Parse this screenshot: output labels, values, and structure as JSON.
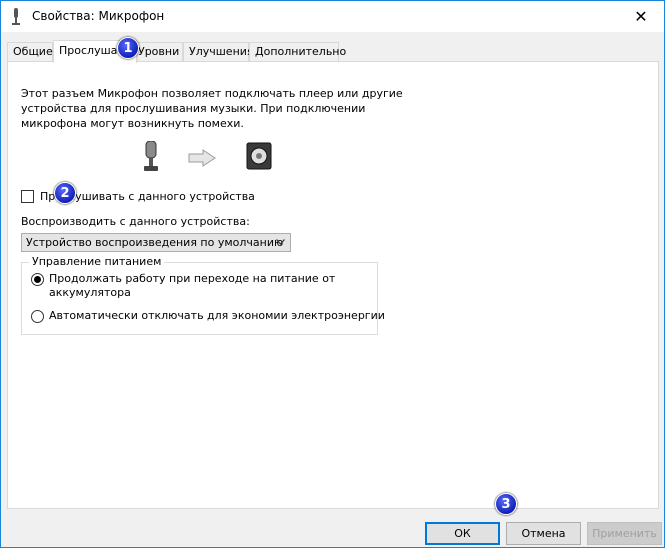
{
  "window": {
    "title": "Свойства: Микрофон",
    "close_glyph": "✕",
    "accent": "#1883d7"
  },
  "tabs": [
    {
      "label": "Общие",
      "active": false
    },
    {
      "label": "Прослушать",
      "active": true
    },
    {
      "label": "Уровни",
      "active": false
    },
    {
      "label": "Улучшения",
      "active": false
    },
    {
      "label": "Дополнительно",
      "active": false
    }
  ],
  "listen": {
    "description_lines": [
      "Этот разъем Микрофон позволяет подключать плеер или другие",
      "устройства для прослушивания музыки. При подключении",
      "микрофона могут возникнуть помехи."
    ],
    "diagram_icons": [
      "microphone-icon",
      "arrow-right-icon",
      "speaker-icon"
    ],
    "listen_checkbox_label": "Прослушивать с данного устройства",
    "listen_checked": false,
    "playback_label": "Воспроизводить с данного устройства:",
    "playback_device": "Устройство воспроизведения по умолчанию"
  },
  "power": {
    "title": "Управление питанием",
    "option1_lines": [
      "Продолжать работу при переходе на питание от",
      "аккумулятора"
    ],
    "option1_checked": true,
    "option2": "Автоматически отключать для экономии электроэнергии",
    "option2_checked": false
  },
  "buttons": {
    "ok": "ОК",
    "cancel": "Отмена",
    "apply": "Применить"
  },
  "annotations": [
    "1",
    "2",
    "3"
  ]
}
